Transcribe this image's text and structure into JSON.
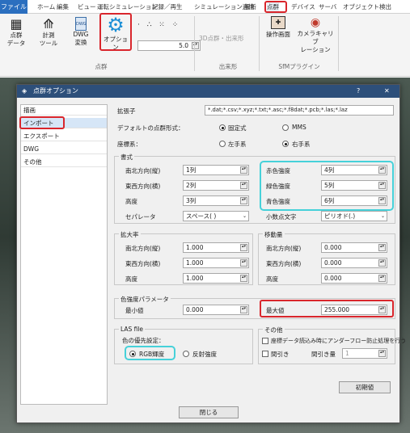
{
  "tabs": [
    "ファイル",
    "ホーム",
    "編集",
    "ビュー",
    "運転シミュレーション",
    "記録／再生",
    "シミュレーション連携",
    "解析",
    "点群",
    "デバイス",
    "サーバ",
    "オブジェクト検出"
  ],
  "ribbon": {
    "pc_data": "点群\nデータ",
    "meas_tool": "計測\nツール",
    "dwg": "DWG\n変換",
    "option": "オプション",
    "size_value": "5.0",
    "group_pointcloud": "点群",
    "shape_3d": "3D点群・出来形",
    "group_shape": "出来形",
    "ops_screen": "操作画面",
    "calib": "カメラキャリブ\nレーション",
    "group_sfm": "SfMプラグイン"
  },
  "dialog": {
    "title": "点群オプション",
    "help": "?",
    "close": "✕",
    "nav": [
      "描画",
      "インポート",
      "エクスポート",
      "DWG",
      "その他"
    ],
    "ext_label": "拡張子",
    "ext_value": "*.dat;*.csv;*.xyz;*.txt;*.asc;*.f8dat;*.pcb;*.las;*.laz",
    "default_format_label": "デフォルトの点群形式：",
    "fixed": "固定式",
    "mms": "MMS",
    "coord_label": "座標系：",
    "left_hand": "左手系",
    "right_hand": "右手系",
    "format_title": "書式",
    "north": "南北方向(縦)",
    "north_val": "1列",
    "east": "東西方向(横)",
    "east_val": "2列",
    "height": "高度",
    "height_val": "3列",
    "red": "赤色強度",
    "red_val": "4列",
    "green": "緑色強度",
    "green_val": "5列",
    "blue": "青色強度",
    "blue_val": "6列",
    "sep": "セパレータ",
    "sep_val": "スペース( )",
    "dec": "小数点文字",
    "dec_val": "ピリオド(.)",
    "scale_title": "拡大率",
    "s_north": "南北方向(縦)",
    "s_north_val": "1.000",
    "s_east": "東西方向(横)",
    "s_east_val": "1.000",
    "s_height": "高度",
    "s_height_val": "1.000",
    "move_title": "移動量",
    "m_north": "南北方向(縦)",
    "m_north_val": "0.000",
    "m_east": "東西方向(横)",
    "m_east_val": "0.000",
    "m_height": "高度",
    "m_height_val": "0.000",
    "color_title": "色強度パラメータ",
    "min": "最小値",
    "min_val": "0.000",
    "max": "最大値",
    "max_val": "255.000",
    "las_title": "LAS file",
    "las_pri": "色の優先設定：",
    "rgb": "RGB輝度",
    "refl": "反射強度",
    "other_title": "その他",
    "underflow": "座標データ読込み時にアンダーフロー防止処理を行う",
    "thin": "間引き",
    "thin_amt": "間引き量",
    "thin_val": "1",
    "init": "初期値",
    "close_btn": "閉じる"
  }
}
